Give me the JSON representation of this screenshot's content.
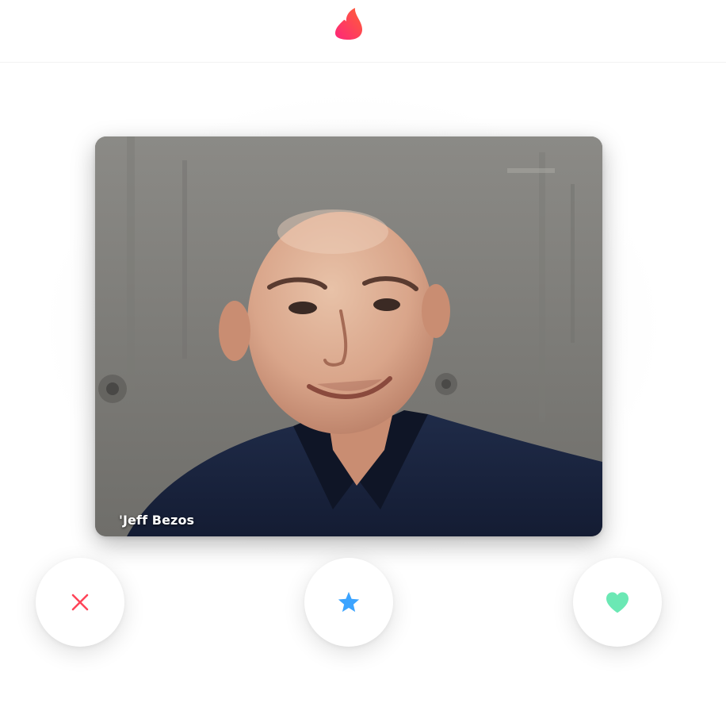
{
  "header": {
    "logo_icon": "flame-icon",
    "logo_colors": [
      "#fd267a",
      "#ff6036"
    ]
  },
  "card": {
    "name": "'Jeff Bezos",
    "photo_icon": "profile-photo"
  },
  "actions": {
    "nope": {
      "icon": "close-icon",
      "color": "#ff4458"
    },
    "super_like": {
      "icon": "star-icon",
      "color": "#3ca4ff"
    },
    "like": {
      "icon": "heart-icon",
      "color": "#6be8b4"
    }
  }
}
